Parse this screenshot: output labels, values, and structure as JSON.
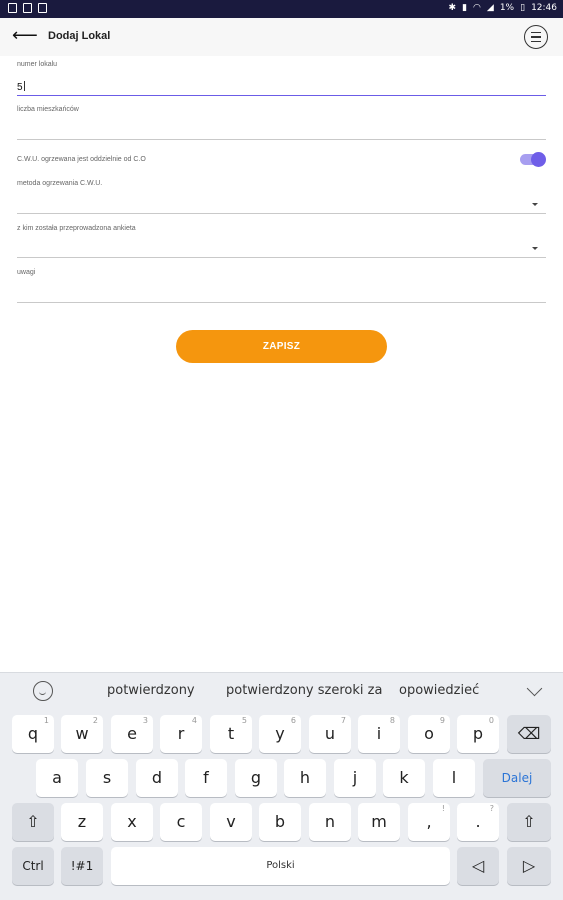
{
  "status": {
    "battery": "1%",
    "time": "12:46"
  },
  "appbar": {
    "title": "Dodaj Lokal"
  },
  "form": {
    "numer_lokalu": {
      "label": "numer lokalu",
      "value": "5"
    },
    "liczba": {
      "label": "liczba mieszkańców",
      "value": ""
    },
    "cwu_toggle": {
      "label": "C.W.U. ogrzewana jest oddzielnie od C.O",
      "checked": true
    },
    "metoda": {
      "label": "metoda ogrzewania C.W.U.",
      "value": ""
    },
    "ankieta": {
      "label": "z kim została przeprowadzona ankieta",
      "value": ""
    },
    "uwagi": {
      "label": "uwagi",
      "value": ""
    },
    "save_label": "ZAPISZ"
  },
  "keyboard": {
    "suggestions": [
      "potwierdzony",
      "potwierdzony szeroki za",
      "opowiedzieć"
    ],
    "row1": [
      {
        "k": "q",
        "h": "1"
      },
      {
        "k": "w",
        "h": "2"
      },
      {
        "k": "e",
        "h": "3"
      },
      {
        "k": "r",
        "h": "4"
      },
      {
        "k": "t",
        "h": "5"
      },
      {
        "k": "y",
        "h": "6"
      },
      {
        "k": "u",
        "h": "7"
      },
      {
        "k": "i",
        "h": "8"
      },
      {
        "k": "o",
        "h": "9"
      },
      {
        "k": "p",
        "h": "0"
      }
    ],
    "row2": [
      "a",
      "s",
      "d",
      "f",
      "g",
      "h",
      "j",
      "k",
      "l"
    ],
    "row3": [
      "z",
      "x",
      "c",
      "v",
      "b",
      "n",
      "m"
    ],
    "dalej": "Dalej",
    "ctrl": "Ctrl",
    "sym": "!#1",
    "space": "Polski",
    "comma": ",",
    "period": "."
  },
  "colors": {
    "accent": "#6f5ee8",
    "save": "#f5960e",
    "statusbar": "#1a1a3e"
  }
}
